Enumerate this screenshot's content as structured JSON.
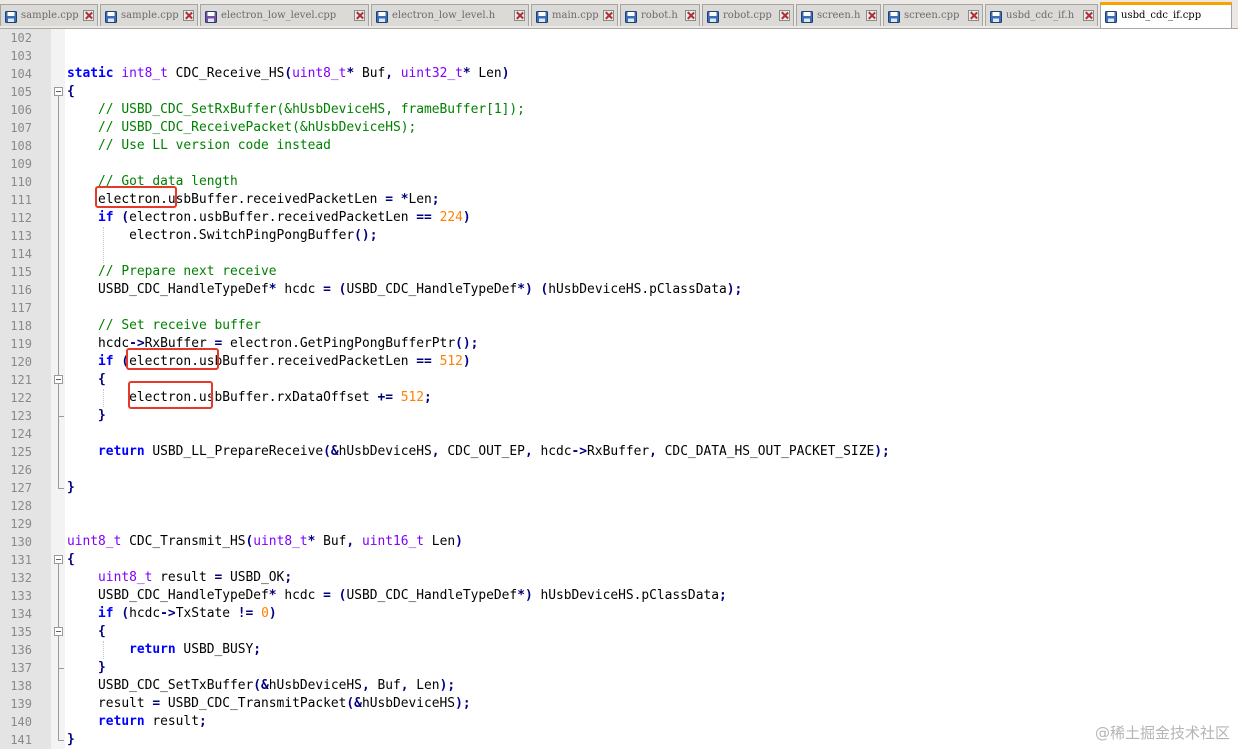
{
  "tabs": [
    {
      "label": "sample.cpp",
      "icon": "save-disk-icon",
      "active": false
    },
    {
      "label": "sample.cpp",
      "icon": "save-disk-icon",
      "active": false
    },
    {
      "label": "electron_low_level.cpp",
      "icon": "save-disk-icon-purple",
      "active": false
    },
    {
      "label": "electron_low_level.h",
      "icon": "save-disk-icon",
      "active": false
    },
    {
      "label": "main.cpp",
      "icon": "save-disk-icon",
      "active": false
    },
    {
      "label": "robot.h",
      "icon": "save-disk-icon",
      "active": false
    },
    {
      "label": "robot.cpp",
      "icon": "save-disk-icon",
      "active": false
    },
    {
      "label": "screen.h",
      "icon": "save-disk-icon",
      "active": false
    },
    {
      "label": "screen.cpp",
      "icon": "save-disk-icon",
      "active": false
    },
    {
      "label": "usbd_cdc_if.h",
      "icon": "save-disk-icon",
      "active": false
    },
    {
      "label": "usbd_cdc_if.cpp",
      "icon": "save-disk-icon",
      "active": true
    }
  ],
  "lines": [
    {
      "n": "102",
      "t": ""
    },
    {
      "n": "103",
      "t": ""
    },
    {
      "n": "104",
      "t": "static int8_t CDC_Receive_HS(uint8_t* Buf, uint32_t* Len)"
    },
    {
      "n": "105",
      "t": "{"
    },
    {
      "n": "106",
      "t": "    // USBD_CDC_SetRxBuffer(&hUsbDeviceHS, frameBuffer[1]);"
    },
    {
      "n": "107",
      "t": "    // USBD_CDC_ReceivePacket(&hUsbDeviceHS);"
    },
    {
      "n": "108",
      "t": "    // Use LL version code instead"
    },
    {
      "n": "109",
      "t": ""
    },
    {
      "n": "110",
      "t": "    // Got data length"
    },
    {
      "n": "111",
      "t": "    electron.usbBuffer.receivedPacketLen = *Len;"
    },
    {
      "n": "112",
      "t": "    if (electron.usbBuffer.receivedPacketLen == 224)"
    },
    {
      "n": "113",
      "t": "        electron.SwitchPingPongBuffer();"
    },
    {
      "n": "114",
      "t": ""
    },
    {
      "n": "115",
      "t": "    // Prepare next receive"
    },
    {
      "n": "116",
      "t": "    USBD_CDC_HandleTypeDef* hcdc = (USBD_CDC_HandleTypeDef*) (hUsbDeviceHS.pClassData);"
    },
    {
      "n": "117",
      "t": ""
    },
    {
      "n": "118",
      "t": "    // Set receive buffer"
    },
    {
      "n": "119",
      "t": "    hcdc->RxBuffer = electron.GetPingPongBufferPtr();"
    },
    {
      "n": "120",
      "t": "    if (electron.usbBuffer.receivedPacketLen == 512)"
    },
    {
      "n": "121",
      "t": "    {"
    },
    {
      "n": "122",
      "t": "        electron.usbBuffer.rxDataOffset += 512;"
    },
    {
      "n": "123",
      "t": "    }"
    },
    {
      "n": "124",
      "t": ""
    },
    {
      "n": "125",
      "t": "    return USBD_LL_PrepareReceive(&hUsbDeviceHS, CDC_OUT_EP, hcdc->RxBuffer, CDC_DATA_HS_OUT_PACKET_SIZE);"
    },
    {
      "n": "126",
      "t": ""
    },
    {
      "n": "127",
      "t": "}"
    },
    {
      "n": "128",
      "t": ""
    },
    {
      "n": "129",
      "t": ""
    },
    {
      "n": "130",
      "t": "uint8_t CDC_Transmit_HS(uint8_t* Buf, uint16_t Len)"
    },
    {
      "n": "131",
      "t": "{"
    },
    {
      "n": "132",
      "t": "    uint8_t result = USBD_OK;"
    },
    {
      "n": "133",
      "t": "    USBD_CDC_HandleTypeDef* hcdc = (USBD_CDC_HandleTypeDef*) hUsbDeviceHS.pClassData;"
    },
    {
      "n": "134",
      "t": "    if (hcdc->TxState != 0)"
    },
    {
      "n": "135",
      "t": "    {"
    },
    {
      "n": "136",
      "t": "        return USBD_BUSY;"
    },
    {
      "n": "137",
      "t": "    }"
    },
    {
      "n": "138",
      "t": "    USBD_CDC_SetTxBuffer(&hUsbDeviceHS, Buf, Len);"
    },
    {
      "n": "139",
      "t": "    result = USBD_CDC_TransmitPacket(&hUsbDeviceHS);"
    },
    {
      "n": "140",
      "t": "    return result;"
    },
    {
      "n": "141",
      "t": "}"
    }
  ],
  "watermark": "@稀土掘金技术社区",
  "colors": {
    "keyword": "#0000ff",
    "type": "#8000ff",
    "number": "#ff8000",
    "comment": "#008000",
    "operator": "#000080",
    "highlight_box": "#e53a2b",
    "active_tab_accent": "#f7a400"
  }
}
